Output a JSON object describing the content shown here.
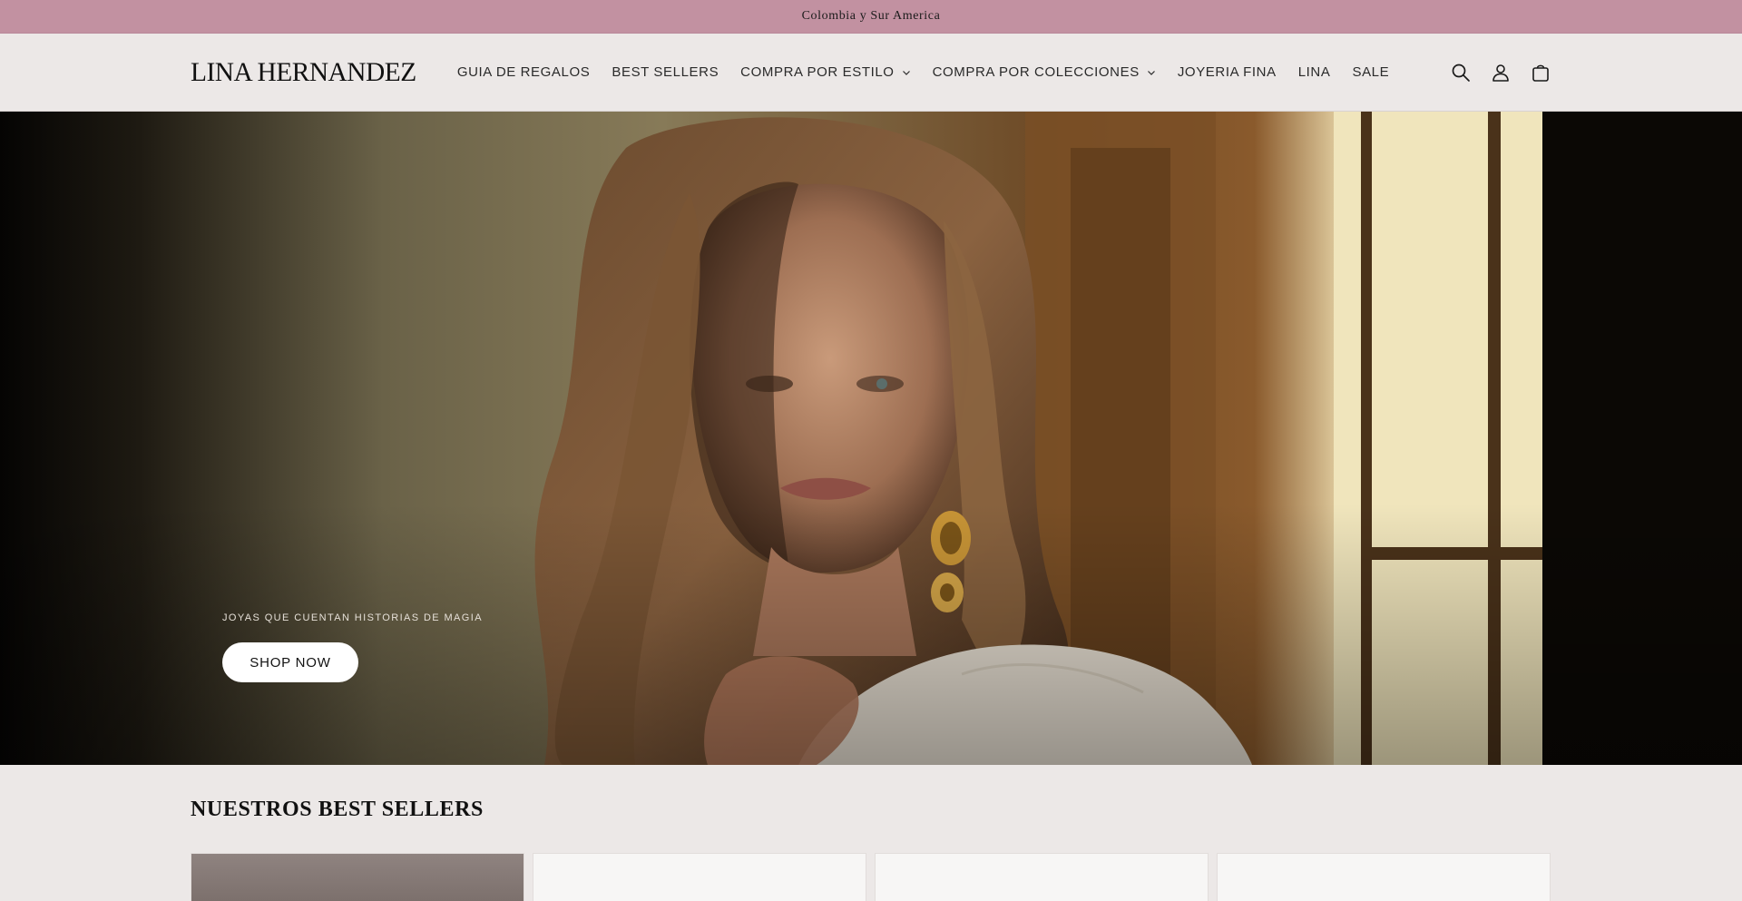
{
  "announcement": {
    "text": "Colombia y Sur America"
  },
  "header": {
    "logo": "LINA HERNANDEZ",
    "nav": [
      {
        "label": "GUIA DE REGALOS",
        "dropdown": false
      },
      {
        "label": "BEST SELLERS",
        "dropdown": false
      },
      {
        "label": "COMPRA POR ESTILO",
        "dropdown": true
      },
      {
        "label": "COMPRA POR COLECCIONES",
        "dropdown": true
      },
      {
        "label": "JOYERIA FINA",
        "dropdown": false
      },
      {
        "label": "LINA",
        "dropdown": false
      },
      {
        "label": "SALE",
        "dropdown": false
      }
    ],
    "icons": [
      "search-icon",
      "account-icon",
      "cart-icon"
    ]
  },
  "hero": {
    "tagline": "JOYAS QUE CUENTAN HISTORIAS DE MAGIA",
    "button_label": "SHOP NOW"
  },
  "best_sellers": {
    "title": "NUESTROS BEST SELLERS",
    "cards_visible": 4
  },
  "colors": {
    "announcement_bg": "#c291a1",
    "page_bg": "#ece8e7",
    "button_bg": "#ffffff"
  }
}
